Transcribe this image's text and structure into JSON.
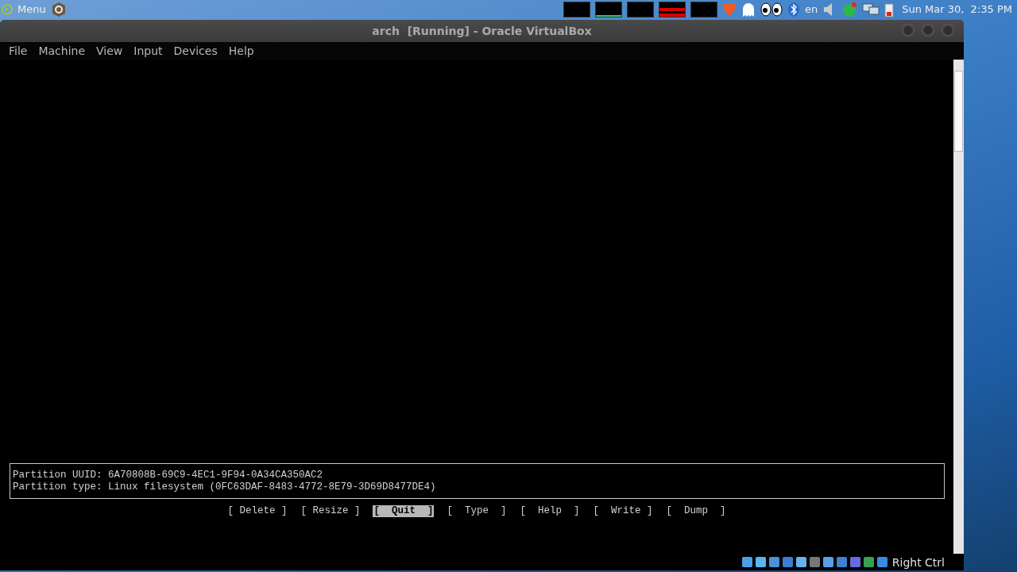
{
  "panel": {
    "menu_label": "Menu",
    "keyboard_layout": "en",
    "clock": "Sun Mar 30,  2:35 PM"
  },
  "window": {
    "title": "arch  [Running] - Oracle VirtualBox"
  },
  "menu": [
    "File",
    "Machine",
    "View",
    "Input",
    "Devices",
    "Help"
  ],
  "console": {
    "info_lines": [
      "Partition UUID: 6A70808B-69C9-4EC1-9F94-0A34CA350AC2",
      "Partition type: Linux filesystem (0FC63DAF-8483-4772-8E79-3D69D8477DE4)"
    ],
    "buttons": [
      {
        "label": "[ Delete ]",
        "selected": false
      },
      {
        "label": "[ Resize ]",
        "selected": false
      },
      {
        "label": "[  Quit  ]",
        "selected": true
      },
      {
        "label": "[  Type  ]",
        "selected": false
      },
      {
        "label": "[  Help  ]",
        "selected": false
      },
      {
        "label": "[  Write ]",
        "selected": false
      },
      {
        "label": "[  Dump  ]",
        "selected": false
      }
    ]
  },
  "status_bar": {
    "host_key": "Right Ctrl"
  }
}
